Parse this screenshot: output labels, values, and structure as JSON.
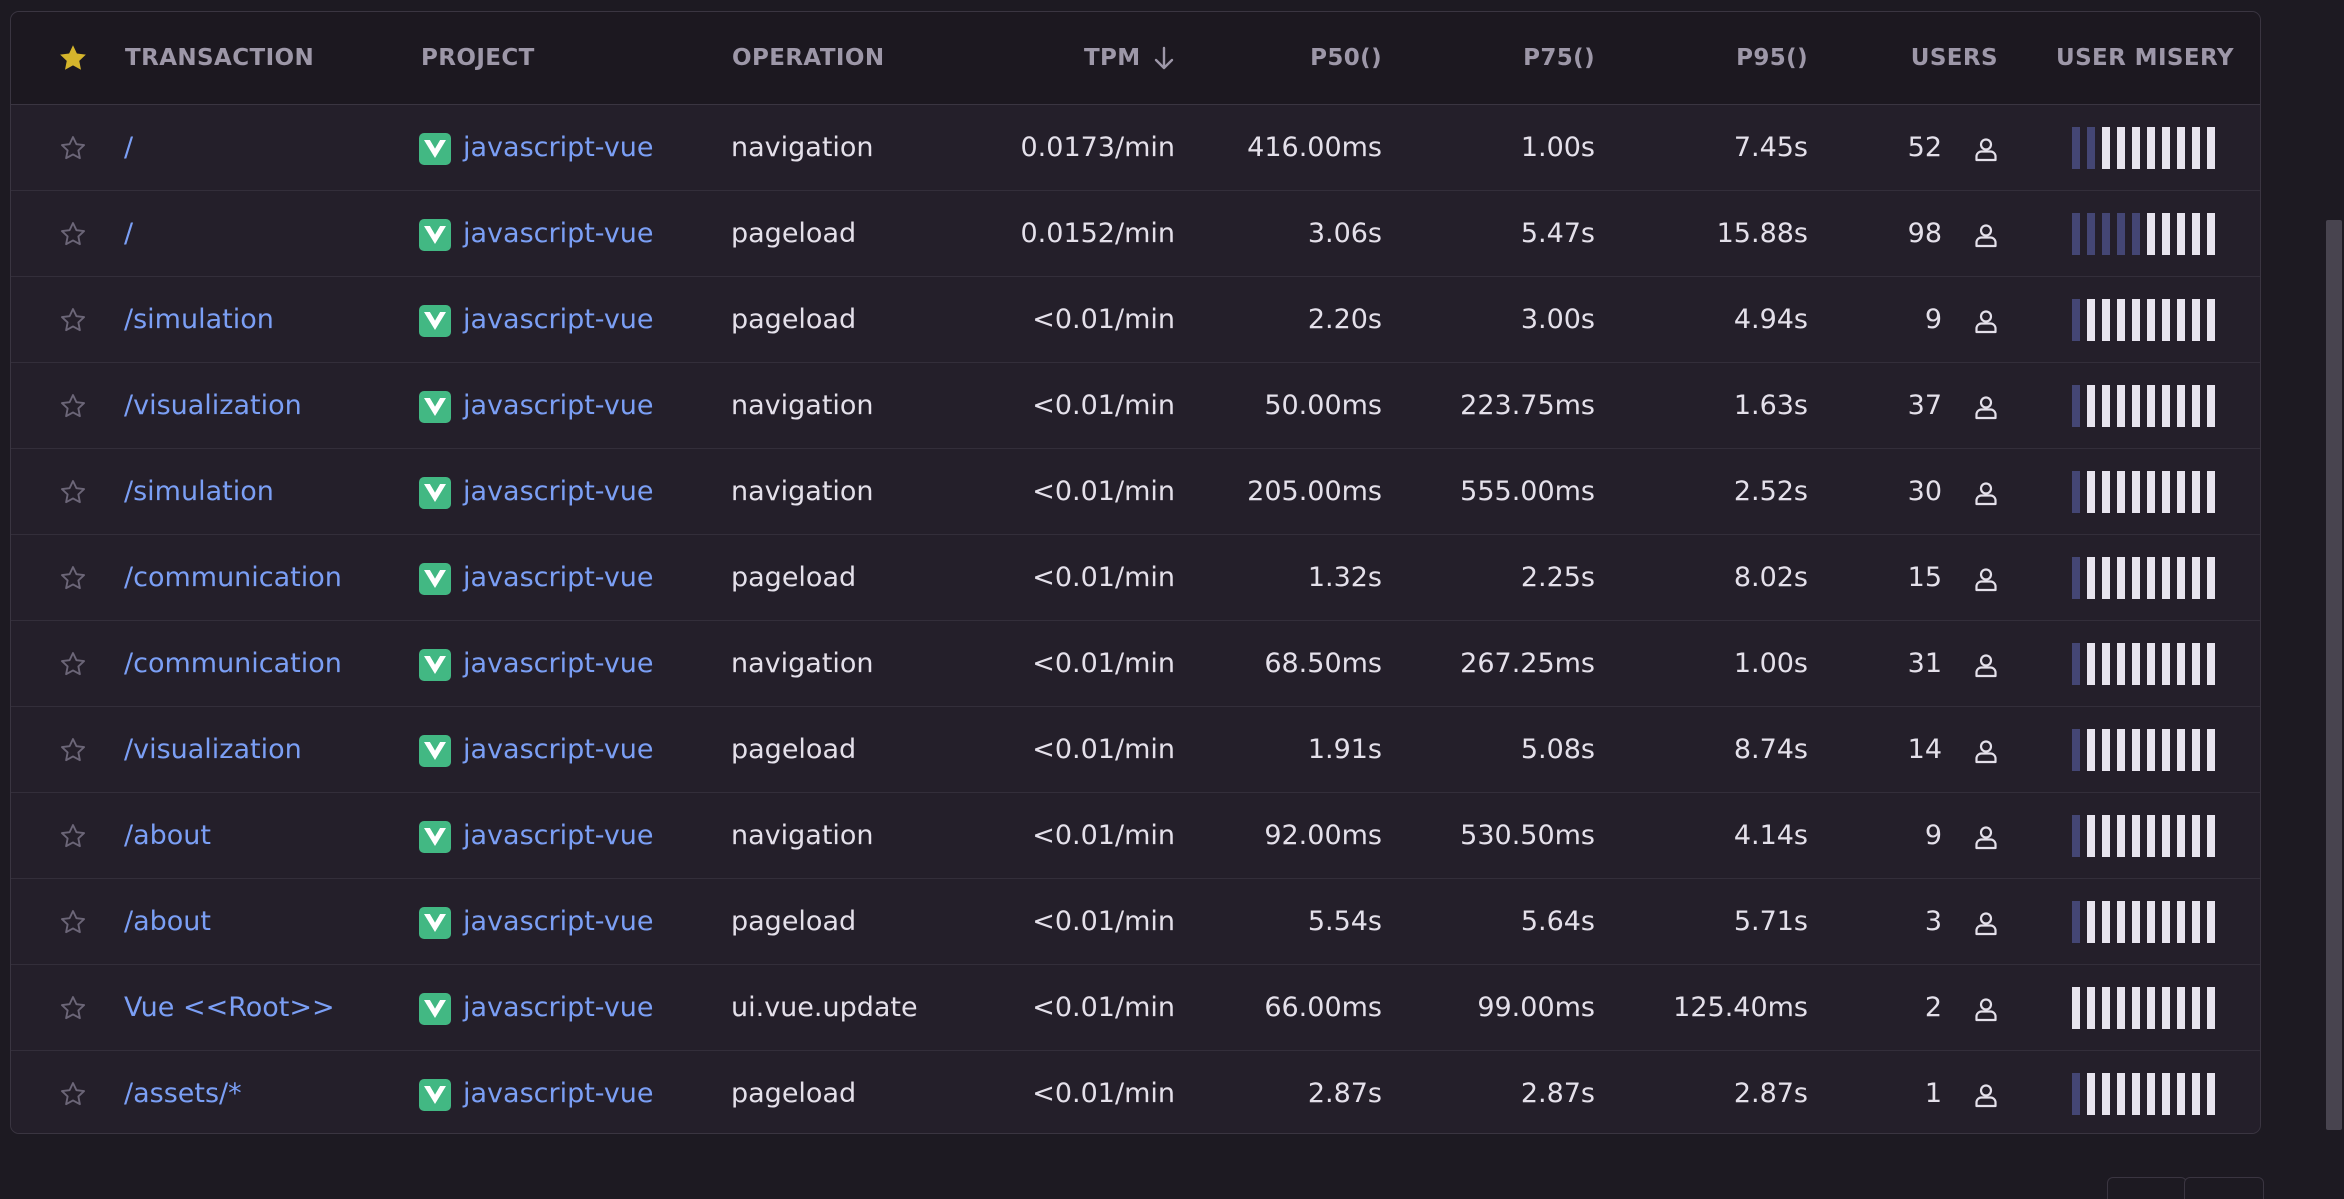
{
  "headers": {
    "transaction": "TRANSACTION",
    "project": "PROJECT",
    "operation": "OPERATION",
    "tpm": "TPM",
    "p50": "P50()",
    "p75": "P75()",
    "p95": "P95()",
    "users": "USERS",
    "user_misery": "USER MISERY"
  },
  "colors": {
    "accent_link": "#7b9ff5",
    "vue_green": "#42b883",
    "star_header": "#d5b52c",
    "misery_filled": "#444674",
    "misery_empty": "#e7e4ee"
  },
  "icons": {
    "header_star": "star-filled-icon",
    "row_star": "star-outline-icon",
    "sort": "arrow-down-icon",
    "project": "vue-logo-icon",
    "users": "user-icon"
  },
  "rows": [
    {
      "transaction": "/",
      "project": "javascript-vue",
      "operation": "navigation",
      "tpm": "0.0173/min",
      "p50": "416.00ms",
      "p75": "1.00s",
      "p95": "7.45s",
      "users": "52",
      "misery_filled": 2
    },
    {
      "transaction": "/",
      "project": "javascript-vue",
      "operation": "pageload",
      "tpm": "0.0152/min",
      "p50": "3.06s",
      "p75": "5.47s",
      "p95": "15.88s",
      "users": "98",
      "misery_filled": 5
    },
    {
      "transaction": "/simulation",
      "project": "javascript-vue",
      "operation": "pageload",
      "tpm": "<0.01/min",
      "p50": "2.20s",
      "p75": "3.00s",
      "p95": "4.94s",
      "users": "9",
      "misery_filled": 1
    },
    {
      "transaction": "/visualization",
      "project": "javascript-vue",
      "operation": "navigation",
      "tpm": "<0.01/min",
      "p50": "50.00ms",
      "p75": "223.75ms",
      "p95": "1.63s",
      "users": "37",
      "misery_filled": 1
    },
    {
      "transaction": "/simulation",
      "project": "javascript-vue",
      "operation": "navigation",
      "tpm": "<0.01/min",
      "p50": "205.00ms",
      "p75": "555.00ms",
      "p95": "2.52s",
      "users": "30",
      "misery_filled": 1
    },
    {
      "transaction": "/communication",
      "project": "javascript-vue",
      "operation": "pageload",
      "tpm": "<0.01/min",
      "p50": "1.32s",
      "p75": "2.25s",
      "p95": "8.02s",
      "users": "15",
      "misery_filled": 1
    },
    {
      "transaction": "/communication",
      "project": "javascript-vue",
      "operation": "navigation",
      "tpm": "<0.01/min",
      "p50": "68.50ms",
      "p75": "267.25ms",
      "p95": "1.00s",
      "users": "31",
      "misery_filled": 1
    },
    {
      "transaction": "/visualization",
      "project": "javascript-vue",
      "operation": "pageload",
      "tpm": "<0.01/min",
      "p50": "1.91s",
      "p75": "5.08s",
      "p95": "8.74s",
      "users": "14",
      "misery_filled": 1
    },
    {
      "transaction": "/about",
      "project": "javascript-vue",
      "operation": "navigation",
      "tpm": "<0.01/min",
      "p50": "92.00ms",
      "p75": "530.50ms",
      "p95": "4.14s",
      "users": "9",
      "misery_filled": 1
    },
    {
      "transaction": "/about",
      "project": "javascript-vue",
      "operation": "pageload",
      "tpm": "<0.01/min",
      "p50": "5.54s",
      "p75": "5.64s",
      "p95": "5.71s",
      "users": "3",
      "misery_filled": 1
    },
    {
      "transaction": "Vue <<Root>>",
      "project": "javascript-vue",
      "operation": "ui.vue.update",
      "tpm": "<0.01/min",
      "p50": "66.00ms",
      "p75": "99.00ms",
      "p95": "125.40ms",
      "users": "2",
      "misery_filled": 0
    },
    {
      "transaction": "/assets/*",
      "project": "javascript-vue",
      "operation": "pageload",
      "tpm": "<0.01/min",
      "p50": "2.87s",
      "p75": "2.87s",
      "p95": "2.87s",
      "users": "1",
      "misery_filled": 1
    }
  ]
}
